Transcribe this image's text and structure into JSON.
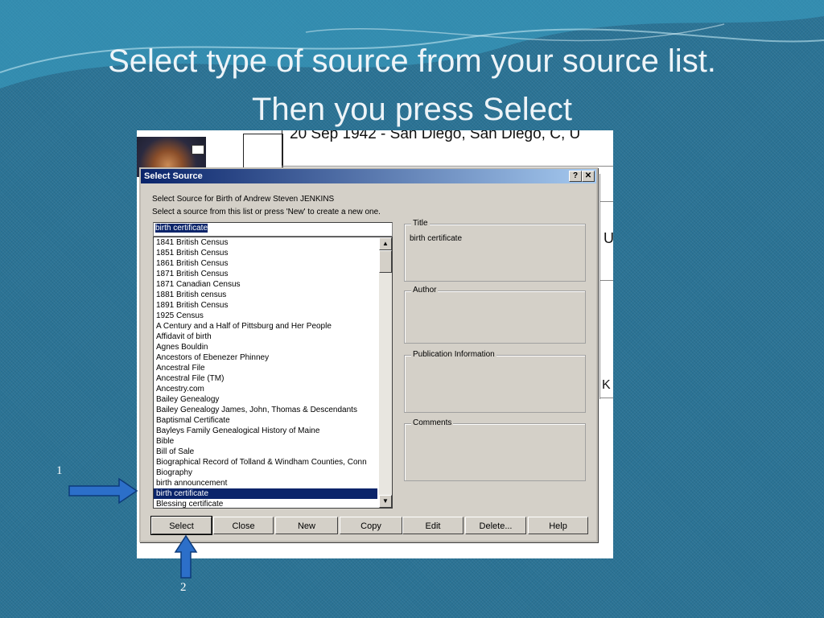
{
  "slide": {
    "title_line1": "Select type of source from your source list.",
    "title_line2": "Then you press Select",
    "callout_1": "1",
    "callout_2": "2"
  },
  "background_app": {
    "event_text": "20 Sep 1942 - San Diego, San Diego, C, U",
    "fragment_u": "U",
    "fragment_k": "K"
  },
  "dialog": {
    "title": "Select Source",
    "help_btn": "?",
    "close_btn": "✕",
    "instruction_1": "Select Source for Birth of Andrew Steven JENKINS",
    "instruction_2": "Select a source from this list or press 'New' to create a new one.",
    "search_value": "birth certificate",
    "sources": [
      "1841 British Census",
      "1851 British Census",
      "1861 British Census",
      "1871 British Census",
      "1871 Canadian Census",
      "1881 British census",
      "1891 British Census",
      "1925 Census",
      "A Century and a Half of Pittsburg and Her People",
      "Affidavit of birth",
      "Agnes Bouldin",
      "Ancestors of Ebenezer Phinney",
      "Ancestral File",
      "Ancestral File (TM)",
      "Ancestry.com",
      "Bailey Genealogy",
      "Bailey Genealogy James, John, Thomas & Descendants",
      "Baptismal Certificate",
      "Bayleys Family Genealogical History of Maine",
      "Bible",
      "Bill of Sale",
      "Biographical Record of Tolland & Windham Counties, Conn",
      "Biography",
      "birth announcement",
      "birth certificate",
      "Blessing certificate"
    ],
    "selected_index": 24,
    "title_group": {
      "label": "Title",
      "value": "birth certificate"
    },
    "author_group": {
      "label": "Author",
      "value": ""
    },
    "publication_group": {
      "label": "Publication Information",
      "value": ""
    },
    "comments_group": {
      "label": "Comments",
      "value": ""
    },
    "buttons": {
      "select": "Select",
      "close": "Close",
      "new": "New",
      "copy": "Copy",
      "edit": "Edit",
      "delete": "Delete...",
      "help": "Help"
    }
  },
  "colors": {
    "background": "#2b7395",
    "titlebar": "#0a246a",
    "selection": "#0a246a",
    "arrow": "#2c6fc9"
  }
}
